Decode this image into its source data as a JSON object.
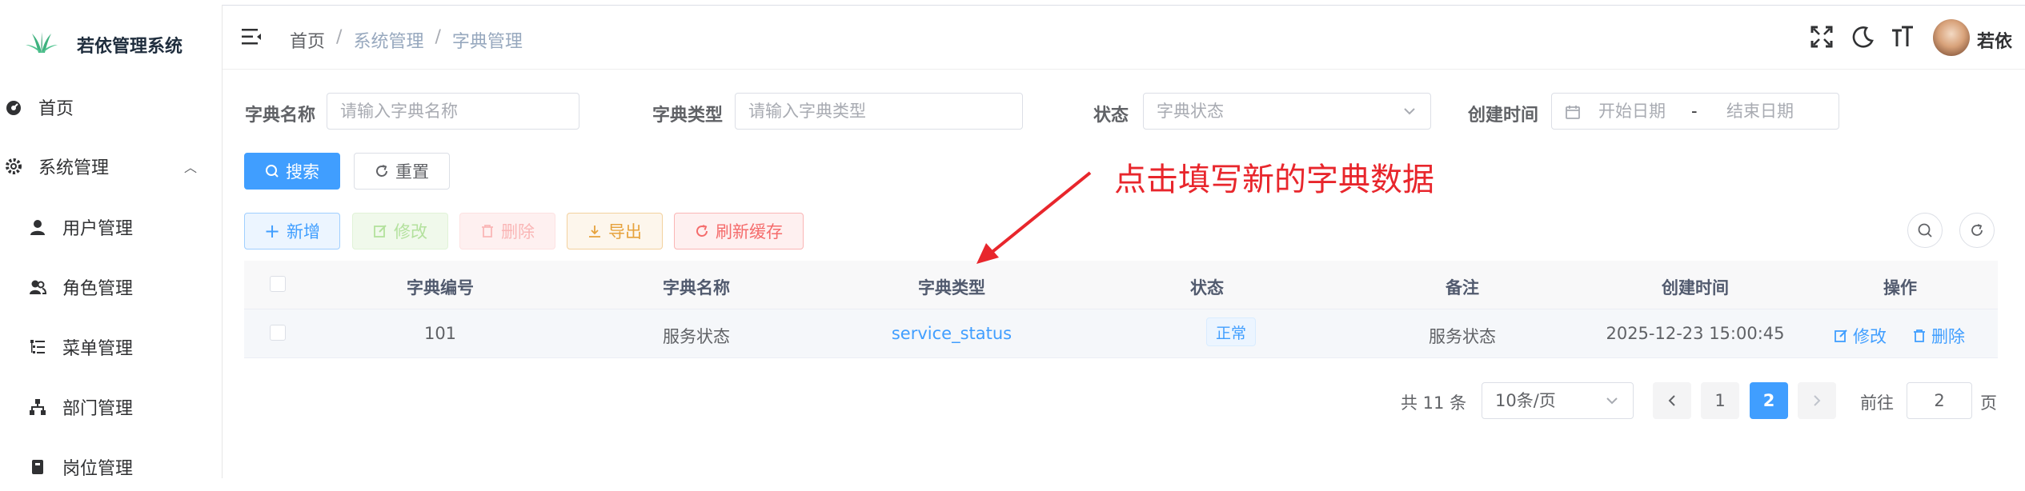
{
  "app": {
    "title": "若依管理系统"
  },
  "sidebar": {
    "items": [
      {
        "label": "首页",
        "icon": "dashboard-icon"
      },
      {
        "label": "系统管理",
        "icon": "gear-icon"
      },
      {
        "label": "用户管理",
        "icon": "user-icon"
      },
      {
        "label": "角色管理",
        "icon": "peoples-icon"
      },
      {
        "label": "菜单管理",
        "icon": "tree-table-icon"
      },
      {
        "label": "部门管理",
        "icon": "tree-icon"
      },
      {
        "label": "岗位管理",
        "icon": "post-icon"
      }
    ]
  },
  "header": {
    "breadcrumb": [
      "首页",
      "系统管理",
      "字典管理"
    ],
    "separator": "/",
    "username": "若依"
  },
  "search": {
    "dict_name_label": "字典名称",
    "dict_name_placeholder": "请输入字典名称",
    "dict_type_label": "字典类型",
    "dict_type_placeholder": "请输入字典类型",
    "status_label": "状态",
    "status_placeholder": "字典状态",
    "created_label": "创建时间",
    "start_placeholder": "开始日期",
    "range_sep": "-",
    "end_placeholder": "结束日期",
    "search_button": "搜索",
    "reset_button": "重置"
  },
  "toolbar": {
    "add": "新增",
    "edit": "修改",
    "delete": "删除",
    "export": "导出",
    "refresh_cache": "刷新缓存"
  },
  "table": {
    "columns": [
      "字典编号",
      "字典名称",
      "字典类型",
      "状态",
      "备注",
      "创建时间",
      "操作"
    ],
    "rows": [
      {
        "id": "101",
        "name": "服务状态",
        "type": "service_status",
        "status": "正常",
        "remark": "服务状态",
        "created": "2025-12-23 15:00:45",
        "edit": "修改",
        "delete": "删除"
      }
    ]
  },
  "pagination": {
    "total_text": "共 11 条",
    "page_size": "10条/页",
    "pages": [
      "1",
      "2"
    ],
    "current_page": "2",
    "goto_label": "前往",
    "goto_value": "2",
    "page_unit": "页"
  },
  "annotation": {
    "text": "点击填写新的字典数据",
    "color": "#e8262c"
  },
  "colors": {
    "primary": "#409eff",
    "danger": "#f56c6c",
    "warning": "#e6a23c",
    "success": "#67c23a"
  }
}
